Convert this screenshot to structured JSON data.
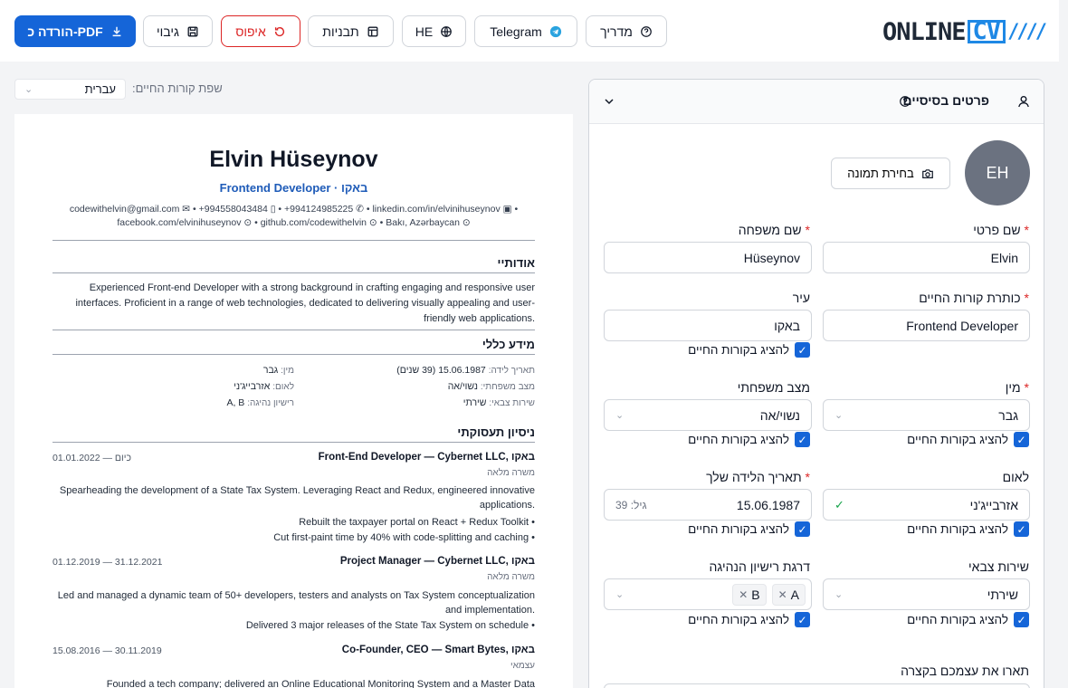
{
  "toolbar": {
    "download_pdf": "הורדה כ-PDF",
    "backup": "גיבוי",
    "reset": "איפוס",
    "templates": "תבניות",
    "language": "HE",
    "telegram": "Telegram",
    "guide": "מדריך"
  },
  "logo": {
    "part1": "ONLINE",
    "part2": "CV",
    "part3": "////"
  },
  "resume_language": {
    "label": "שפת קורות החיים:",
    "value": "עברית"
  },
  "cv": {
    "name": "Elvin Hüseynov",
    "title": "Frontend Developer · באקו",
    "contacts_line1": "codewithelvin@gmail.com ✉ • +994558043484 ▯ • +994124985225 ✆ • linkedin.com/in/elvinihuseynov ▣ •",
    "contacts_line2": "facebook.com/elvinihuseynov ⊙ • github.com/codewithelvin ⊙ • Bakı, Azərbaycan ⊙",
    "about_heading": "אודותיי",
    "about_text": "Experienced Front-end Developer with a strong background in crafting engaging and responsive user interfaces. Proficient in a range of web technologies, dedicated to delivering visually appealing and user-friendly web applications.",
    "general_heading": "מידע כללי",
    "general": {
      "birth_key": "תאריך לידה:",
      "birth_val": "15.06.1987 (39 שנים)",
      "gender_key": "מין:",
      "gender_val": "גבר",
      "marital_key": "מצב משפחתי:",
      "marital_val": "נשוי/אה",
      "nationality_key": "לאום:",
      "nationality_val": "אזרבייג'ני",
      "military_key": "שירות צבאי:",
      "military_val": "שירתי",
      "license_key": "רישיון נהיגה:",
      "license_val": "A, B"
    },
    "experience_heading": "ניסיון תעסוקתי",
    "jobs": [
      {
        "title": "Front-End Developer — Cybernet LLC, באקו",
        "date": "01.01.2022 — כיום",
        "type": "משרה מלאה",
        "desc": "Spearheading the development of a State Tax System. Leveraging React and Redux, engineered innovative applications.",
        "bullets": [
          "Rebuilt the taxpayer portal on React + Redux Toolkit",
          "Cut first-paint time by 40% with code-splitting and caching"
        ]
      },
      {
        "title": "Project Manager — Cybernet LLC, באקו",
        "date": "01.12.2019 — 31.12.2021",
        "type": "משרה מלאה",
        "desc": "Led and managed a dynamic team of 50+ developers, testers and analysts on Tax System conceptualization and implementation.",
        "bullets": [
          "Delivered 3 major releases of the State Tax System on schedule"
        ]
      },
      {
        "title": "Co-Founder, CEO — Smart Bytes, באקו",
        "date": "15.08.2016 — 30.11.2019",
        "type": "עצמאי",
        "desc": "Founded a tech company; delivered an Online Educational Monitoring System and a Master Data",
        "bullets": []
      }
    ]
  },
  "form": {
    "section_title": "פרטים בסיסיים",
    "avatar_initials": "EH",
    "choose_photo": "בחירת תמונה",
    "first_name_label": "שם פרטי",
    "first_name": "Elvin",
    "last_name_label": "שם משפחה",
    "last_name": "Hüseynov",
    "cv_title_label": "כותרת קורות החיים",
    "cv_title": "Frontend Developer",
    "city_label": "עיר",
    "city": "באקו",
    "show_in_cv": "להציג בקורות החיים",
    "gender_label": "מין",
    "gender": "גבר",
    "marital_label": "מצב משפחתי",
    "marital": "נשוי/אה",
    "nationality_label": "לאום",
    "nationality": "אזרבייג'ני",
    "birth_label": "תאריך הלידה שלך",
    "birth": "15.06.1987",
    "age": "גיל: 39",
    "military_label": "שירות צבאי",
    "military": "שירתי",
    "license_label": "דרגת רישיון הנהיגה",
    "license_tags": [
      "A",
      "B"
    ],
    "about_label": "תארו את עצמכם בקצרה"
  },
  "colors": {
    "primary": "#1565d8",
    "danger": "#dc2626",
    "accent_text": "#1e5bb8"
  }
}
